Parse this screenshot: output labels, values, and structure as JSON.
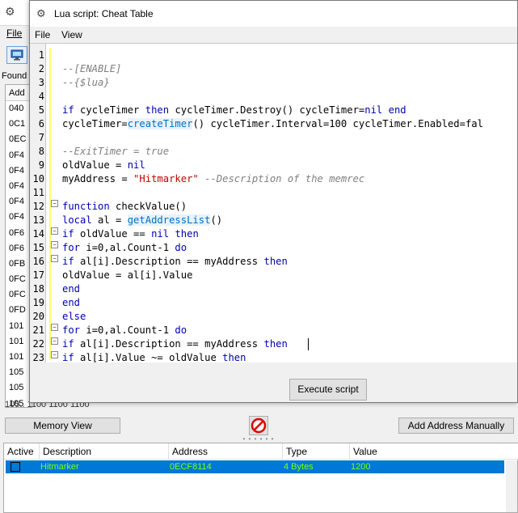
{
  "main_window": {
    "menu_file": "File",
    "found_label": "Found",
    "list_header": "Add",
    "list_rows": [
      "040",
      "0C1",
      "0EC",
      "0F4",
      "0F4",
      "0F4",
      "0F4",
      "0F4",
      "0F6",
      "0F6",
      "0FB",
      "0FC",
      "0FC",
      "0FD",
      "101",
      "101",
      "101",
      "105",
      "105",
      "105"
    ],
    "bottom_row_fragment": "105..  1100    1100    1100",
    "memory_view_label": "Memory View",
    "add_address_label": "Add Address Manually",
    "table_headers": {
      "active": "Active",
      "description": "Description",
      "address": "Address",
      "type": "Type",
      "value": "Value"
    },
    "table_rows": [
      {
        "description": "Hitmarker",
        "address": "0ECF8114",
        "type": "4 Bytes",
        "value": "1200"
      }
    ]
  },
  "lua_window": {
    "title": "Lua script: Cheat Table",
    "menu_file": "File",
    "menu_view": "View",
    "execute_label": "Execute script",
    "line_numbers": [
      "1",
      "2",
      "3",
      "4",
      "5",
      "6",
      "7",
      "8",
      "9",
      "10",
      "11",
      "12",
      "13",
      "14",
      "15",
      "16",
      "17",
      "18",
      "19",
      "20",
      "21",
      "22",
      "23"
    ]
  },
  "colors": {
    "selection": "#0078d7",
    "row_text": "#7fff00",
    "keyword": "#0000b0",
    "comment": "#808080",
    "string": "#c00000"
  },
  "icons": [
    "app-icon",
    "computer-icon",
    "stop-icon",
    "lua-app-icon"
  ]
}
